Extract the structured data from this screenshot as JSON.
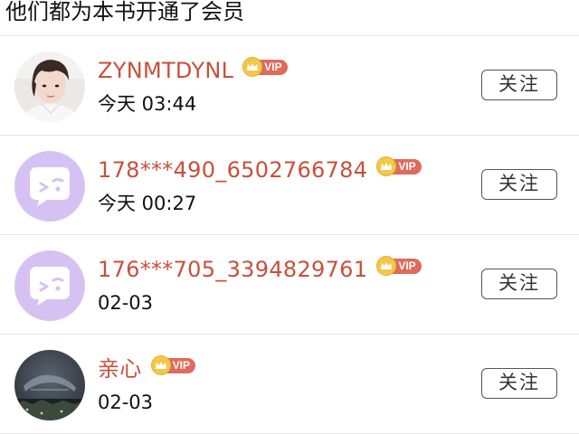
{
  "header": {
    "title": "他们都为本书开通了会员"
  },
  "members": [
    {
      "username": "ZYNMTDYNL",
      "vip_label": "VIP",
      "time": "今天 03:44",
      "follow_label": "关注",
      "avatar_icon": "person-photo-avatar"
    },
    {
      "username": "178***490_6502766784",
      "vip_label": "VIP",
      "time": "今天 00:27",
      "follow_label": "关注",
      "avatar_icon": "default-chat-bubble-avatar"
    },
    {
      "username": "176***705_3394829761",
      "vip_label": "VIP",
      "time": "02-03",
      "follow_label": "关注",
      "avatar_icon": "default-chat-bubble-avatar"
    },
    {
      "username": "亲心",
      "vip_label": "VIP",
      "time": "02-03",
      "follow_label": "关注",
      "avatar_icon": "night-city-photo-avatar"
    }
  ],
  "colors": {
    "username": "#c8503a",
    "vip_badge": "#e06a5c",
    "vip_crown": "#f3c84a",
    "default_avatar": "#d6c2f2"
  }
}
